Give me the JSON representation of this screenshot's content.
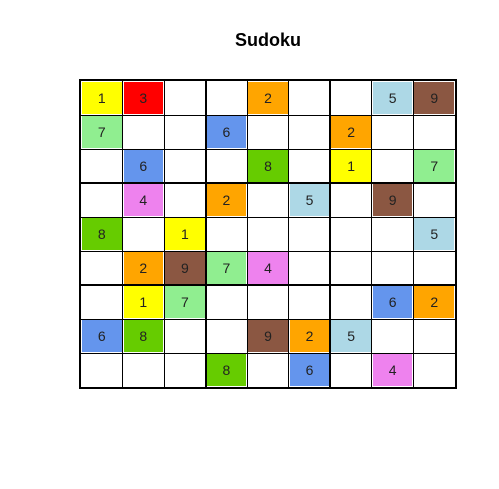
{
  "title": "Sudoku",
  "colors": {
    "1": "#ffff00",
    "2": "#ffa500",
    "3": "#ff0000",
    "4": "#ee82ee",
    "5": "#add8e6",
    "6": "#6495ed",
    "7": "#90ee90",
    "8": "#66cc00",
    "9": "#8b5742",
    "empty": "#ffffff",
    "grid": "#000000",
    "digit": "#222222"
  },
  "grid": [
    [
      "1",
      "3",
      "",
      "",
      "2",
      "",
      "",
      "5",
      "9"
    ],
    [
      "7",
      "",
      "",
      "6",
      "",
      "",
      "2",
      "",
      ""
    ],
    [
      "",
      "6",
      "",
      "",
      "8",
      "",
      "1",
      "",
      "7"
    ],
    [
      "",
      "4",
      "",
      "2",
      "",
      "5",
      "",
      "9",
      ""
    ],
    [
      "8",
      "",
      "1",
      "",
      "",
      "",
      "",
      "",
      "5"
    ],
    [
      "",
      "2",
      "9",
      "7",
      "4",
      "",
      "",
      "",
      ""
    ],
    [
      "",
      "1",
      "7",
      "",
      "",
      "",
      "",
      "6",
      "2"
    ],
    [
      "6",
      "8",
      "",
      "",
      "9",
      "2",
      "5",
      "",
      ""
    ],
    [
      "",
      "",
      "",
      "8",
      "",
      "6",
      "",
      "4",
      ""
    ]
  ]
}
